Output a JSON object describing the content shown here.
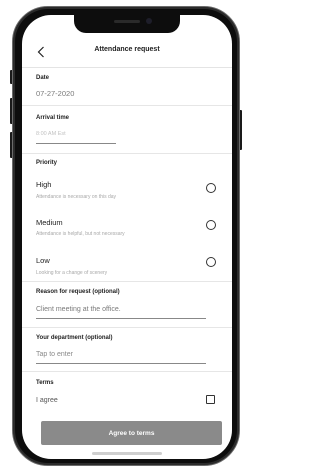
{
  "header": {
    "title": "Attendance request",
    "back_icon": "chevron-left-icon"
  },
  "date": {
    "label": "Date",
    "value": "07-27-2020"
  },
  "arrival": {
    "label": "Arrival time",
    "placeholder": "8:00 AM Est"
  },
  "priority": {
    "label": "Priority",
    "options": [
      {
        "title": "High",
        "description": "Attendance is necessary on this day",
        "selected": false
      },
      {
        "title": "Medium",
        "description": "Attendance is helpful, but not necessary",
        "selected": false
      },
      {
        "title": "Low",
        "description": "Looking for a change of scenery",
        "selected": false
      }
    ]
  },
  "reason": {
    "label": "Reason for request (optional)",
    "value": "Client meeting at the office."
  },
  "department": {
    "label": "Your department (optional)",
    "placeholder": "Tap to enter"
  },
  "terms": {
    "label": "Terms",
    "agree_text": "I agree",
    "checked": false
  },
  "cta": {
    "label": "Agree to terms"
  },
  "colors": {
    "cta_background": "#8a8a8a",
    "phone_frame": "#0d0d0d"
  }
}
